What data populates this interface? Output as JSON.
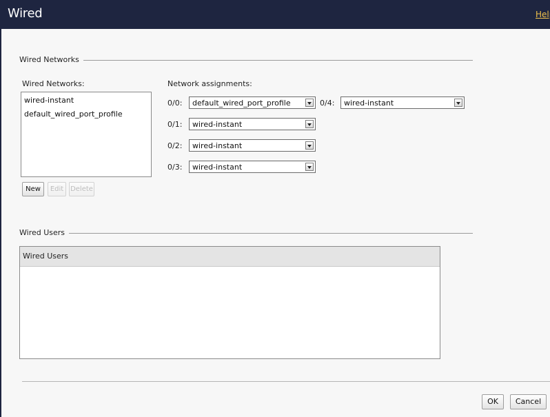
{
  "window": {
    "title": "Wired",
    "help_label": "Help"
  },
  "wired_networks_section": {
    "legend": "Wired Networks",
    "list_label": "Wired Networks:",
    "items": [
      "wired-instant",
      "default_wired_port_profile"
    ],
    "buttons": {
      "new": "New",
      "edit": "Edit",
      "delete": "Delete"
    }
  },
  "network_assignments": {
    "label": "Network assignments:",
    "ports": [
      {
        "port": "0/0:",
        "value": "default_wired_port_profile"
      },
      {
        "port": "0/1:",
        "value": "wired-instant"
      },
      {
        "port": "0/2:",
        "value": "wired-instant"
      },
      {
        "port": "0/3:",
        "value": "wired-instant"
      },
      {
        "port": "0/4:",
        "value": "wired-instant"
      }
    ]
  },
  "wired_users_section": {
    "legend": "Wired Users",
    "table_header": "Wired Users"
  },
  "footer": {
    "ok": "OK",
    "cancel": "Cancel"
  },
  "colors": {
    "titlebar": "#1e2540",
    "help_link": "#f0c14b",
    "background": "#f7f7f7"
  }
}
